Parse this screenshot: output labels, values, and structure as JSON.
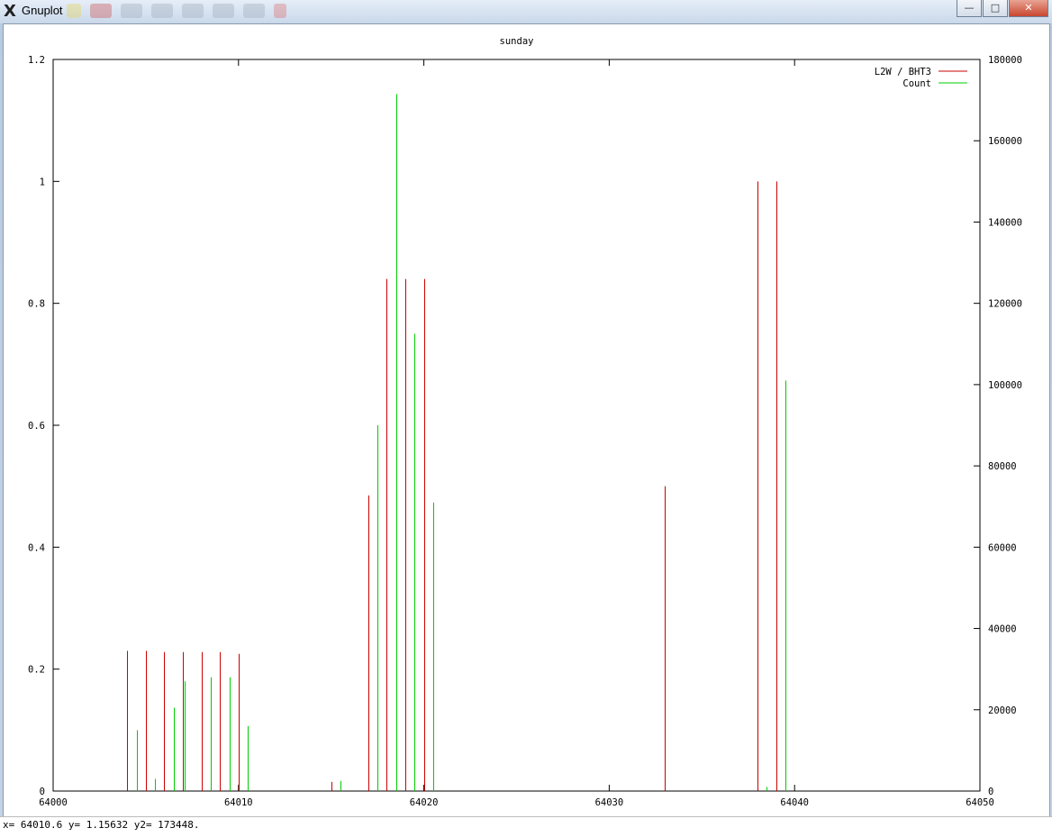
{
  "window": {
    "title": "Gnuplot",
    "app_icon": "X",
    "controls": {
      "minimize": "—",
      "maximize": "□",
      "close": "✕"
    },
    "toolbar_icons": [
      "bookmark-icon",
      "print-icon",
      "copy-icon",
      "clipboard-icon",
      "replot-icon",
      "grid-icon",
      "mouse-icon",
      "export-icon"
    ]
  },
  "status": {
    "text": "x= 64010.6 y= 1.15632 y2= 173448."
  },
  "colors": {
    "series1": "#cc0000",
    "series2": "#00cc00",
    "axis": "#000000",
    "background": "#ffffff"
  },
  "chart_data": {
    "type": "bar",
    "title": "sunday",
    "xlabel": "",
    "ylabel": "",
    "y2label": "",
    "xlim": [
      64000,
      64050
    ],
    "ylim": [
      0,
      1.2
    ],
    "y2lim": [
      0,
      180000
    ],
    "x_ticks": [
      "64000",
      "64010",
      "64020",
      "64030",
      "64040",
      "64050"
    ],
    "y_ticks": [
      "0",
      "0.2",
      "0.4",
      "0.6",
      "0.8",
      "1",
      "1.2"
    ],
    "y2_ticks": [
      "0",
      "20000",
      "40000",
      "60000",
      "80000",
      "100000",
      "120000",
      "140000",
      "160000",
      "180000"
    ],
    "legend_position": "top-right",
    "grid": false,
    "series": [
      {
        "name": "L2W / BHT3",
        "axis": "y",
        "style": "impulses",
        "x": [
          64004,
          64005,
          64006,
          64007,
          64008,
          64009,
          64010,
          64015,
          64017,
          64018,
          64019,
          64020,
          64033,
          64038,
          64039
        ],
        "values": [
          0.23,
          0.23,
          0.228,
          0.228,
          0.228,
          0.228,
          0.225,
          0.015,
          0.485,
          0.84,
          0.84,
          0.84,
          0.5,
          1.0,
          1.0
        ]
      },
      {
        "name": "Count",
        "axis": "y2",
        "style": "impulses",
        "x": [
          64004.5,
          64005.5,
          64006.5,
          64007.1,
          64008.5,
          64009.5,
          64010.5,
          64015.5,
          64017.5,
          64018.5,
          64019.5,
          64020.5,
          64038.5,
          64039.5
        ],
        "values": [
          15000,
          3000,
          20500,
          27000,
          28000,
          28000,
          16000,
          2500,
          90000,
          171500,
          112500,
          71000,
          1000,
          101000
        ]
      }
    ]
  }
}
